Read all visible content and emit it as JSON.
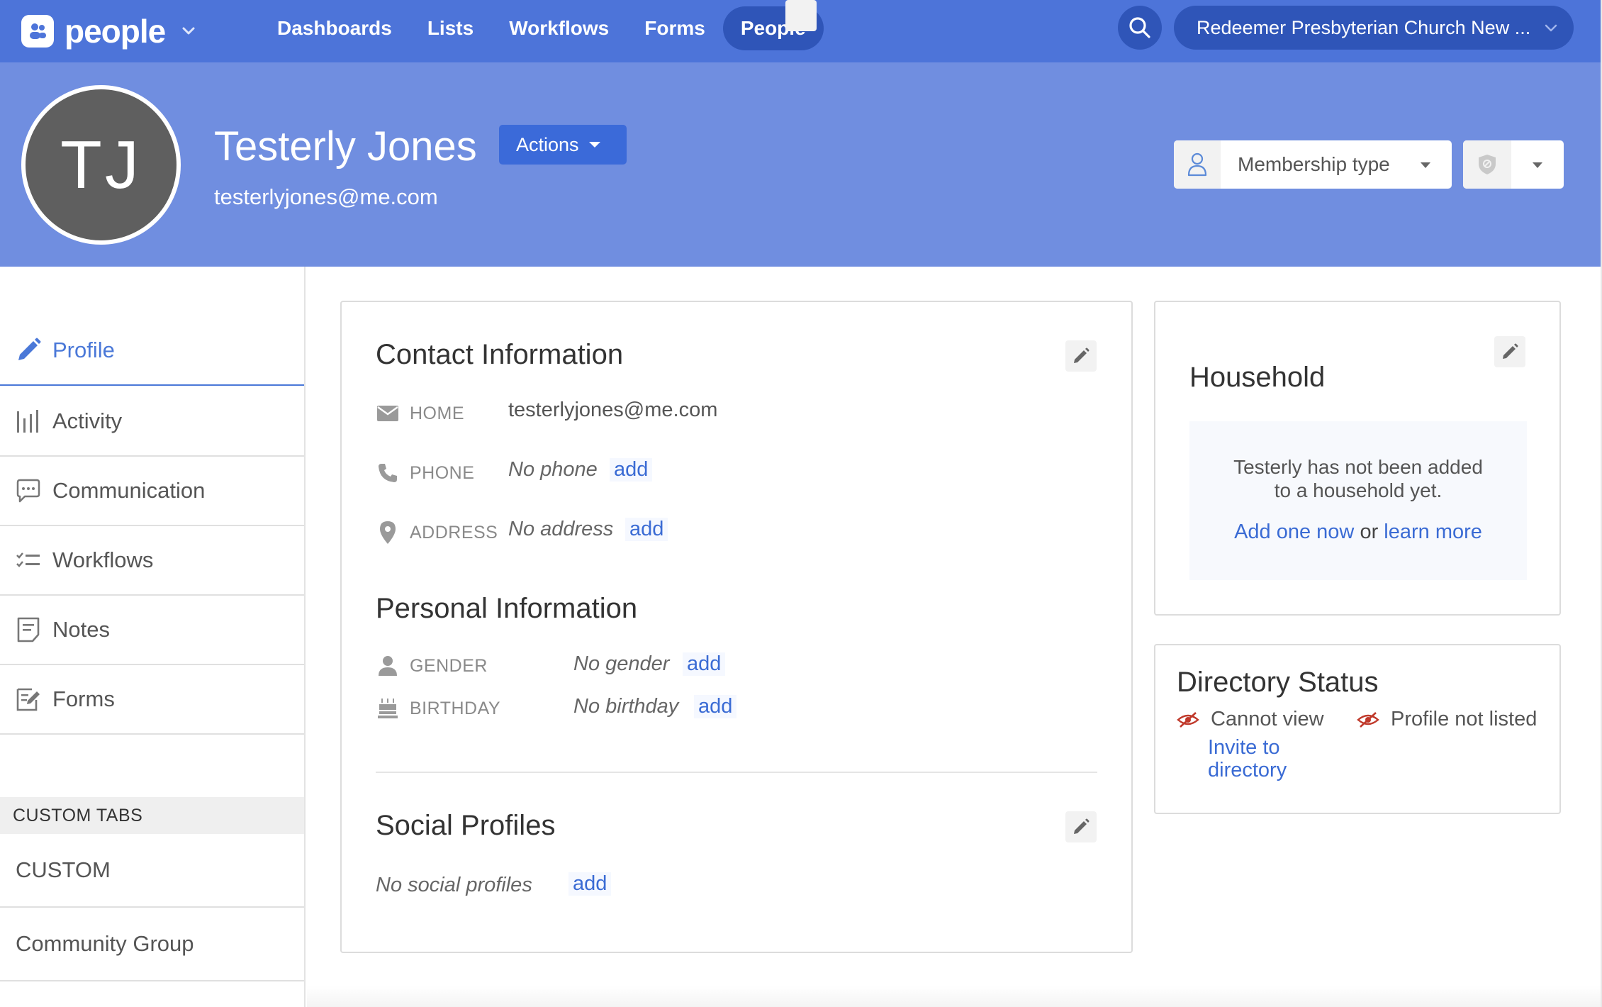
{
  "app": {
    "name": "people",
    "nav": [
      "Dashboards",
      "Lists",
      "Workflows",
      "Forms",
      "People"
    ],
    "active_nav": "People",
    "org_name": "Redeemer Presbyterian Church New ..."
  },
  "person": {
    "initials": "TJ",
    "name": "Testerly Jones",
    "email": "testerlyjones@me.com",
    "actions_label": "Actions",
    "membership_placeholder": "Membership type"
  },
  "sidebar": {
    "items": [
      {
        "label": "Profile",
        "icon": "pencil-icon",
        "active": true
      },
      {
        "label": "Activity",
        "icon": "activity-bars-icon"
      },
      {
        "label": "Communication",
        "icon": "chat-bubble-icon"
      },
      {
        "label": "Workflows",
        "icon": "checklist-icon"
      },
      {
        "label": "Notes",
        "icon": "note-icon"
      },
      {
        "label": "Forms",
        "icon": "form-edit-icon"
      }
    ],
    "custom_tabs_heading": "CUSTOM TABS",
    "custom_tabs": [
      "CUSTOM",
      "Community Group"
    ]
  },
  "contact": {
    "title": "Contact Information",
    "rows": [
      {
        "label": "HOME",
        "value": "testerlyjones@me.com",
        "icon": "mail-icon"
      },
      {
        "label": "PHONE",
        "value": "No phone",
        "add": "add",
        "icon": "phone-icon"
      },
      {
        "label": "ADDRESS",
        "value": "No address",
        "add": "add",
        "icon": "location-pin-icon"
      }
    ]
  },
  "personal": {
    "title": "Personal Information",
    "rows": [
      {
        "label": "GENDER",
        "value": "No gender",
        "add": "add",
        "icon": "person-icon"
      },
      {
        "label": "BIRTHDAY",
        "value": "No birthday",
        "add": "add",
        "icon": "birthday-cake-icon"
      }
    ]
  },
  "social": {
    "title": "Social Profiles",
    "value": "No social profiles",
    "add": "add"
  },
  "household": {
    "title": "Household",
    "line1": "Testerly has not been added",
    "line2": "to a household yet.",
    "add_link": "Add one now",
    "or": "or",
    "learn_link": "learn more"
  },
  "directory": {
    "title": "Directory Status",
    "cannot_view": "Cannot view",
    "invite_line1": "Invite to",
    "invite_line2": "directory",
    "not_listed": "Profile not listed"
  },
  "colors": {
    "nav_bg": "#4d74d9",
    "nav_active": "#2f55b8",
    "header_bg": "#708ee0",
    "link": "#3a6bd4",
    "hidden_eye": "#c0392b"
  }
}
